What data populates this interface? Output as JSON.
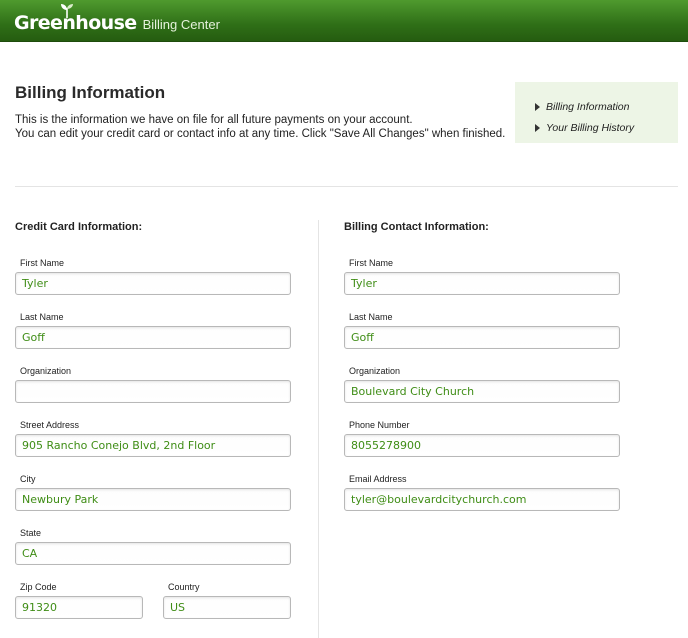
{
  "header": {
    "logo_name": "Greenhouse",
    "logo_sub": "Billing Center"
  },
  "page": {
    "title": "Billing Information",
    "intro_line1": "This is the information we have on file for all future payments on your account.",
    "intro_line2": "You can edit your credit card or contact info at any time. Click \"Save All Changes\" when finished."
  },
  "side_nav": {
    "items": [
      {
        "label": "Billing Information"
      },
      {
        "label": "Your Billing History"
      }
    ]
  },
  "credit_card": {
    "title": "Credit Card Information:",
    "first_name": {
      "label": "First Name",
      "value": "Tyler"
    },
    "last_name": {
      "label": "Last Name",
      "value": "Goff"
    },
    "organization": {
      "label": "Organization",
      "value": ""
    },
    "street": {
      "label": "Street Address",
      "value": "905 Rancho Conejo Blvd, 2nd Floor"
    },
    "city": {
      "label": "City",
      "value": "Newbury Park"
    },
    "state": {
      "label": "State",
      "value": "CA"
    },
    "zip": {
      "label": "Zip Code",
      "value": "91320"
    },
    "country": {
      "label": "Country",
      "value": "US"
    }
  },
  "billing_contact": {
    "title": "Billing Contact Information:",
    "first_name": {
      "label": "First Name",
      "value": "Tyler"
    },
    "last_name": {
      "label": "Last Name",
      "value": "Goff"
    },
    "organization": {
      "label": "Organization",
      "value": "Boulevard City Church"
    },
    "phone": {
      "label": "Phone Number",
      "value": "8055278900"
    },
    "email": {
      "label": "Email Address",
      "value": "tyler@boulevardcitychurch.com"
    }
  },
  "colors": {
    "header_green": "#2f6f17",
    "value_green": "#3f8d16",
    "nav_bg": "#edf5e6"
  },
  "icons": {
    "nav_bullet": "triangle-right-icon",
    "logo_mark": "sprout-icon"
  }
}
